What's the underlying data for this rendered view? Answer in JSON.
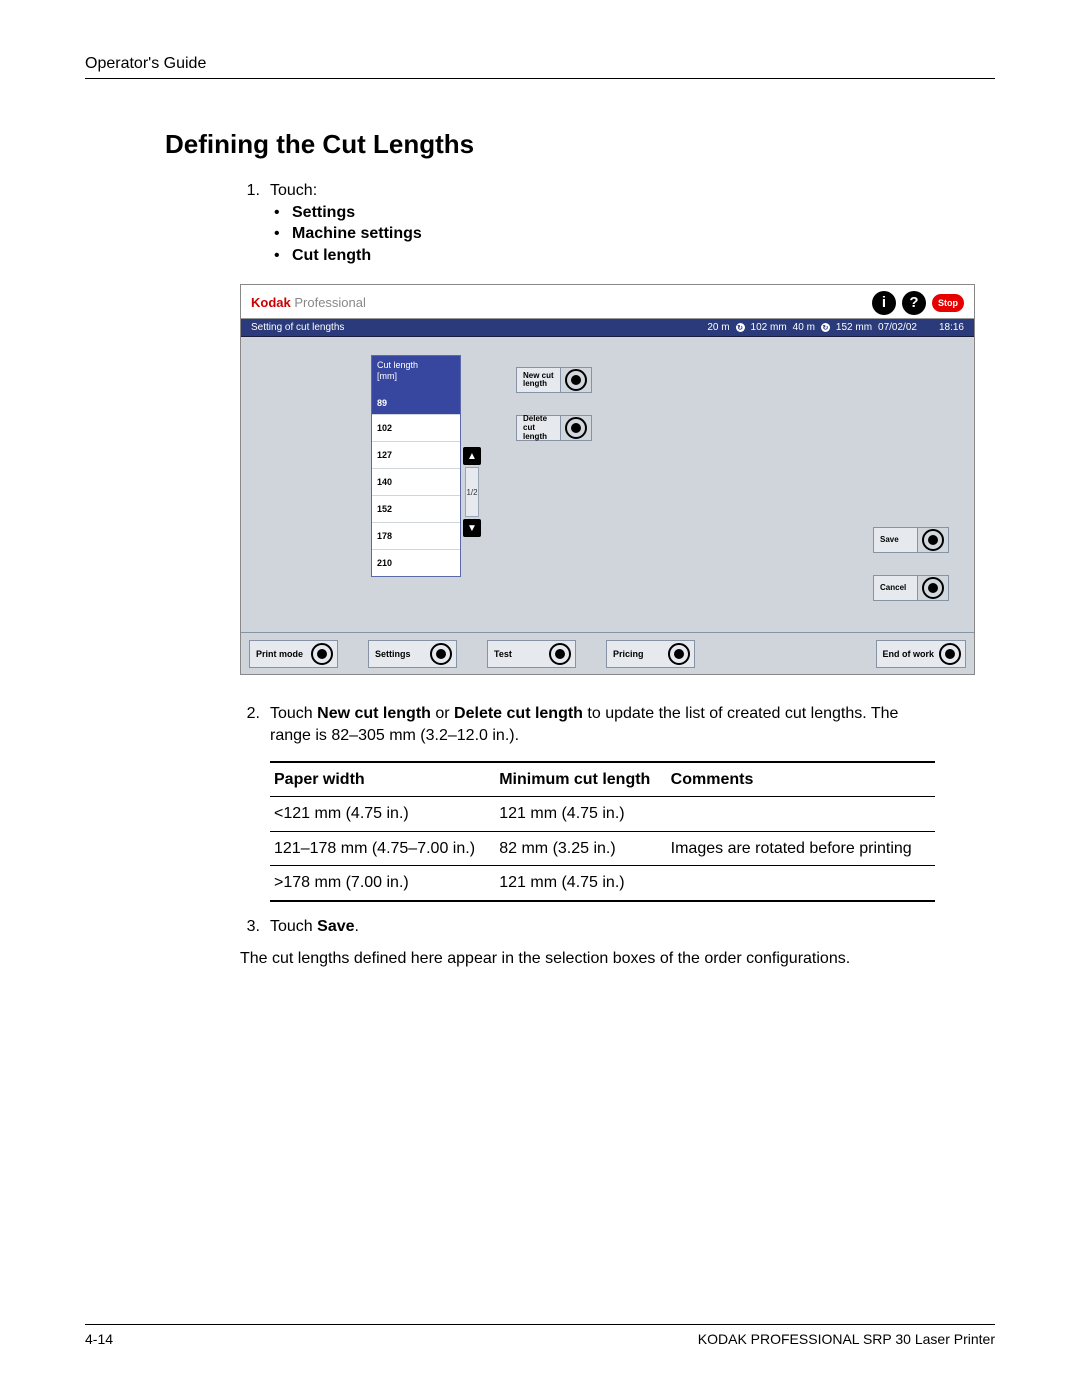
{
  "header": {
    "title": "Operator's Guide"
  },
  "section_title": "Defining the Cut Lengths",
  "step1": {
    "num": "1.",
    "lead": "Touch:",
    "bullets": [
      "Settings",
      "Machine settings",
      "Cut length"
    ]
  },
  "screen": {
    "brand_red": "Kodak",
    "brand_grey": " Professional",
    "stop": "Stop",
    "titlebar_left": "Setting of cut lengths",
    "status": {
      "a": "20 m",
      "a2": "102 mm",
      "b": "40 m",
      "b2": "152 mm",
      "date": "07/02/02",
      "time": "18:16"
    },
    "list": {
      "header_l1": "Cut length",
      "header_l2": "[mm]",
      "selected": "89",
      "rows": [
        "102",
        "127",
        "140",
        "152",
        "178",
        "210"
      ],
      "page_indicator": "1/2"
    },
    "buttons": {
      "new": "New cut length",
      "delete": "Delete cut length",
      "save": "Save",
      "cancel": "Cancel"
    },
    "nav": [
      "Print mode",
      "Settings",
      "Test",
      "Pricing",
      "End of work"
    ]
  },
  "step2": {
    "num": "2.",
    "pre": "Touch ",
    "b1": "New cut length",
    "mid": " or ",
    "b2": "Delete cut length",
    "post": " to update the list of created cut lengths. The range is 82–305 mm (3.2–12.0 in.)."
  },
  "table": {
    "headers": [
      "Paper width",
      "Minimum cut length",
      "Comments"
    ],
    "rows": [
      {
        "w": "<121 mm (4.75 in.)",
        "m": "121 mm (4.75 in.)",
        "c": ""
      },
      {
        "w": "121–178 mm (4.75–7.00 in.)",
        "m": "82 mm (3.25 in.)",
        "c": "Images are rotated before printing"
      },
      {
        "w": ">178 mm (7.00 in.)",
        "m": "121 mm (4.75 in.)",
        "c": ""
      }
    ]
  },
  "step3": {
    "num": "3.",
    "pre": "Touch ",
    "b": "Save",
    "post": "."
  },
  "closing": "The cut lengths defined here appear in the selection boxes of the order configurations.",
  "footer": {
    "left": "4-14",
    "right": "KODAK PROFESSIONAL SRP 30 Laser Printer"
  }
}
